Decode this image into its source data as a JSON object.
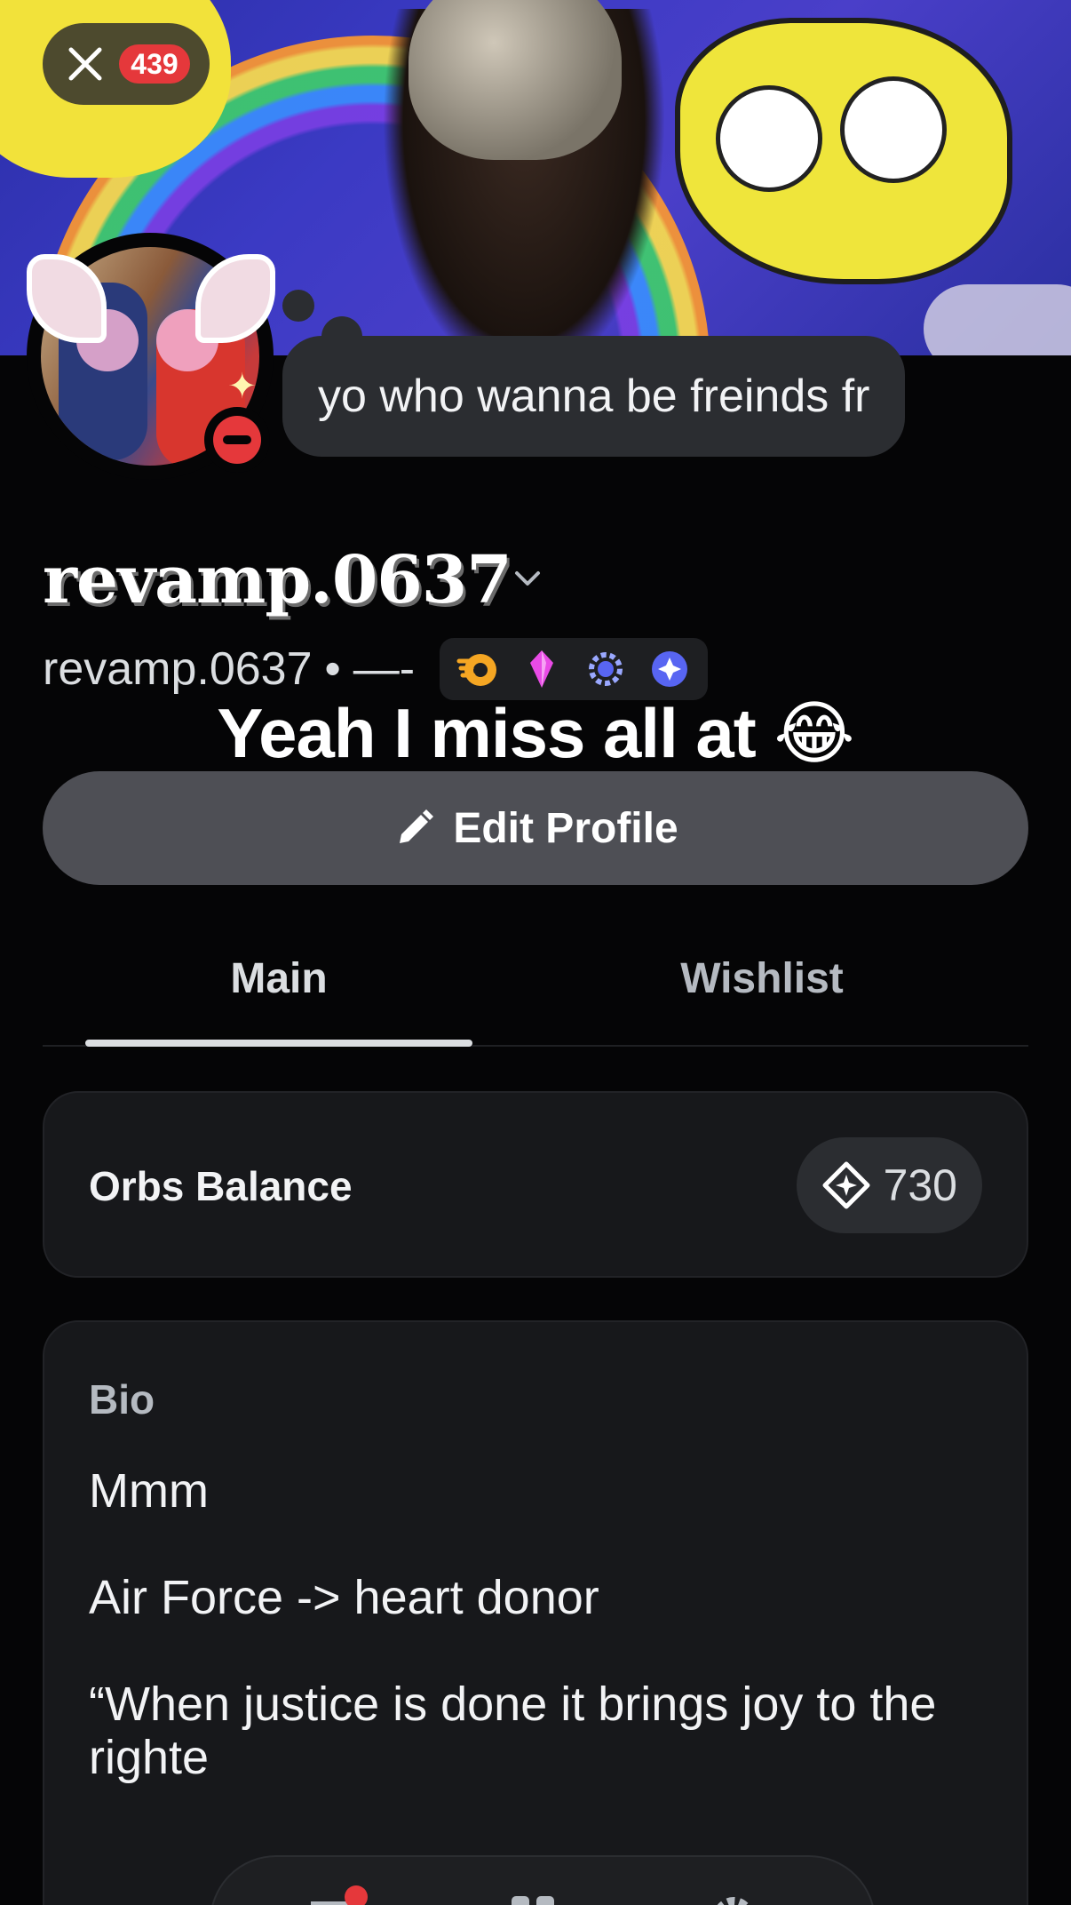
{
  "header": {
    "close_label": "Close",
    "notification_count": "439"
  },
  "profile": {
    "custom_status": "yo who wanna be freinds fr",
    "display_name": "revamp.0637",
    "username": "revamp.0637",
    "separator": "•",
    "pronouns": "—-",
    "status": "do-not-disturb",
    "badges": [
      "orange-quest-badge",
      "pink-gem-badge",
      "laurel-badge",
      "orb-badge"
    ]
  },
  "overlay_caption": "Yeah I miss all at 😂",
  "edit_button": {
    "label": "Edit Profile"
  },
  "tabs": [
    {
      "label": "Main",
      "active": true
    },
    {
      "label": "Wishlist",
      "active": false
    }
  ],
  "orbs": {
    "title": "Orbs Balance",
    "amount": "730"
  },
  "bio": {
    "title": "Bio",
    "text": "Mmm\n\nAir Force -> heart donor\n\n“When justice is done it brings joy to the righte"
  },
  "colors": {
    "background": "#050506",
    "card": "#17181b",
    "button": "#4e4f55",
    "dnd_red": "#e5383b",
    "text": "#f2f3f5",
    "muted": "#b5bac1"
  }
}
